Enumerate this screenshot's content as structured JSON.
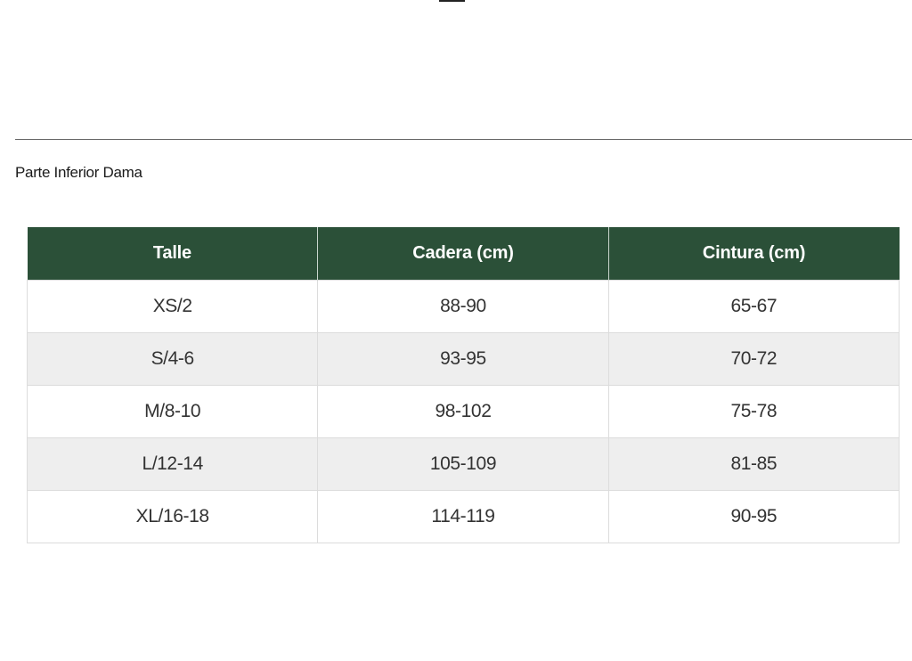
{
  "section_title": "Parte Inferior Dama",
  "table": {
    "headers": [
      "Talle",
      "Cadera (cm)",
      "Cintura (cm)"
    ],
    "rows": [
      [
        "XS/2",
        "88-90",
        "65-67"
      ],
      [
        "S/4-6",
        "93-95",
        "70-72"
      ],
      [
        "M/8-10",
        "98-102",
        "75-78"
      ],
      [
        "L/12-14",
        "105-109",
        "81-85"
      ],
      [
        "XL/16-18",
        "114-119",
        "90-95"
      ]
    ]
  },
  "colors": {
    "header_bg": "#2b5038",
    "header_text": "#ffffff",
    "row_alt_bg": "#eeeeee"
  }
}
